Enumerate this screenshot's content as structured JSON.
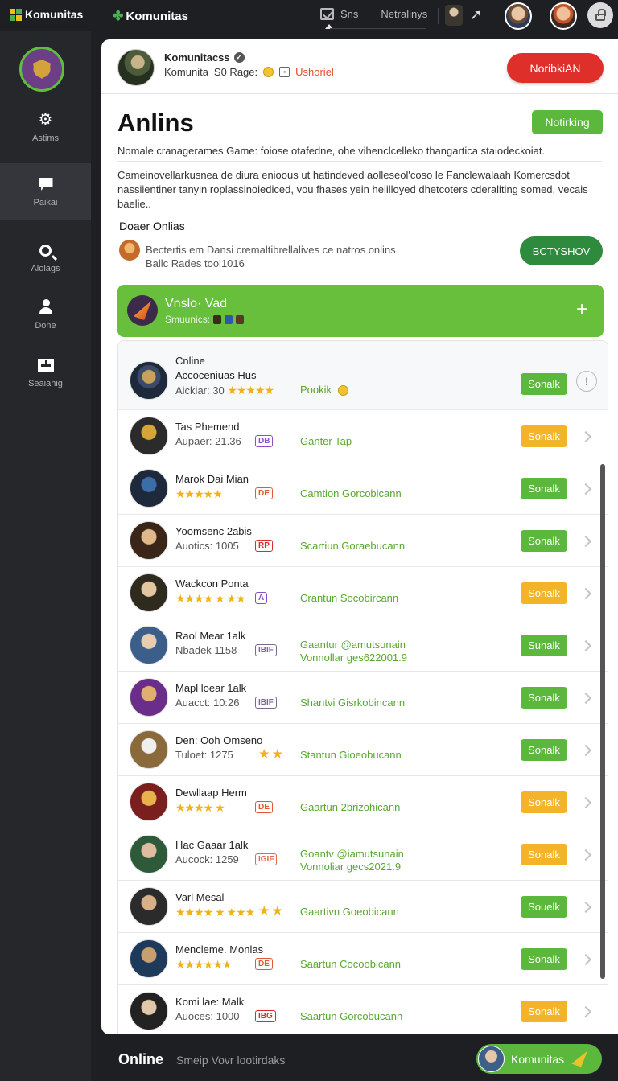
{
  "topbar": {
    "brand_left": "Komunitas",
    "brand_mid": "Komunitas",
    "nav_item_1": "Sns",
    "nav_item_2": "Netralinys"
  },
  "sidebar": {
    "items": [
      {
        "label": "Astims",
        "icon": "gear-icon"
      },
      {
        "label": "Paikai",
        "icon": "flag-icon"
      },
      {
        "label": "Alolags",
        "icon": "search-icon"
      },
      {
        "label": "Done",
        "icon": "person-icon"
      },
      {
        "label": "Seaiahig",
        "icon": "add-box-icon"
      }
    ]
  },
  "header": {
    "name": "Komunitacss",
    "sub_prefix": "Komunita",
    "sub_middle": "S0 Rage:",
    "sub_link": "Ushoriel",
    "notif_button": "NoribkiAN"
  },
  "page": {
    "title": "Anlins",
    "notiking_button": "Notirking",
    "desc1": "Nomale cranagerames Game: foiose otafedne, ohe vihenclcelleko thangartica staiodeckoiat.",
    "desc2": "Cameinovellarkusnea de diura enioous ut hatindeved aolleseol'coso le Fanclewalaah Komercsdot nassiientiner tanyin roplassinoiediced, vou fhases yein heiilloyed dhetcoters cderaliting somed, vecais baelie..",
    "section_title": "Doaer Onlias",
    "creator_line1": "Bectertis em Dansi cremaltibrellalives ce natros onlins",
    "creator_line2": "Ballc Rades tool1016",
    "bctys_button": "BCTYSHOV"
  },
  "banner": {
    "title": "Vnslo· Vad",
    "sub": "Smuunics:"
  },
  "list": {
    "first": {
      "header": "Cnline",
      "name": "Accoceniuas Hus",
      "sub": "Aickiar: 30",
      "tag": "Pookik",
      "button": "Sonalk"
    },
    "rows": [
      {
        "name": "Tas Phemend",
        "sub": "Aupaer: 21.36",
        "badge": "DB",
        "badge_color": "#8a4fc7",
        "status": "Ganter Tap",
        "status2": "",
        "button": "Sonalk",
        "btn": "yellow",
        "sub_is_stars": false
      },
      {
        "name": "Marok Dai Mian",
        "sub": "★★★★★",
        "badge": "DE",
        "badge_color": "#e05a3a",
        "status": "Camtion Gorcobicann",
        "status2": "",
        "button": "Sonalk",
        "btn": "green",
        "sub_is_stars": true
      },
      {
        "name": "Yoomsenc 2abis",
        "sub": "Auotics: 1005",
        "badge": "RP",
        "badge_color": "#d92b2b",
        "status": "Scartiun Goraebucann",
        "status2": "",
        "button": "Sonalk",
        "btn": "green",
        "sub_is_stars": false
      },
      {
        "name": "Wackcon Ponta",
        "sub": "★★★★ ★ ★★",
        "badge": "A",
        "badge_color": "#8a4fc7",
        "status": "Crantun Socobircann",
        "status2": "",
        "button": "Sonalk",
        "btn": "yellow",
        "sub_is_stars": true
      },
      {
        "name": "Raol Mear 1alk",
        "sub": "Nbadek 1158",
        "badge": "IBIF",
        "badge_color": "#7a6a8a",
        "status": "Gaantur @amutsunain",
        "status2": "Vonnollar ges622001.9",
        "button": "Sunalk",
        "btn": "green",
        "sub_is_stars": false
      },
      {
        "name": "Mapl loear 1alk",
        "sub": "Auacct: 10:26",
        "badge": "IBIF",
        "badge_color": "#7a6a8a",
        "status": "Shantvi Gisrkobincann",
        "status2": "",
        "button": "Sonalk",
        "btn": "green",
        "sub_is_stars": false
      },
      {
        "name": "Den: Ooh Omseno",
        "sub": "Tuloet: 1275",
        "badge": "",
        "badge_color": "#f0b21a",
        "status": "Stantun Gioeobucann",
        "status2": "",
        "button": "Sonalk",
        "btn": "green",
        "sub_is_stars": false
      },
      {
        "name": "Dewllaap Herm",
        "sub": "★★★★ ★",
        "badge": "DE",
        "badge_color": "#e05a3a",
        "status": "Gaartun 2brizohicann",
        "status2": "",
        "button": "Sonalk",
        "btn": "yellow",
        "sub_is_stars": true
      },
      {
        "name": "Hac Gaaar 1alk",
        "sub": "Aucock: 1259",
        "badge": "IGIF",
        "badge_color": "#e06a4a",
        "status": "Goantv @iamutsunain",
        "status2": "Vonnoliar gecs2021.9",
        "button": "Sonalk",
        "btn": "yellow",
        "sub_is_stars": false
      },
      {
        "name": "Varl Mesal",
        "sub": "★★★★ ★ ★★★",
        "badge": "",
        "badge_color": "#f0b21a",
        "status": "Gaartivn Goeobicann",
        "status2": "",
        "button": "Souelk",
        "btn": "green",
        "sub_is_stars": true
      },
      {
        "name": "Mencleme. Monlas",
        "sub": "★★★★★★",
        "badge": "DE",
        "badge_color": "#e05a3a",
        "status": "Saartun Cocoobicann",
        "status2": "",
        "button": "Sonalk",
        "btn": "green",
        "sub_is_stars": true
      },
      {
        "name": "Komi lae: Malk",
        "sub": "Auoces: 1000",
        "badge": "IBG",
        "badge_color": "#d92b2b",
        "status": "Saartun Gorcobucann",
        "status2": "",
        "button": "Sonalk",
        "btn": "yellow",
        "sub_is_stars": false
      }
    ]
  },
  "bottombar": {
    "title": "Online",
    "sub": "Smeip Vovr lootirdaks",
    "pill_label": "Komunitas"
  },
  "colors": {
    "accent_green": "#5cb83c",
    "accent_yellow": "#f4b42a",
    "notif_red": "#df2f2a",
    "dark_bg": "#1e1f22"
  }
}
